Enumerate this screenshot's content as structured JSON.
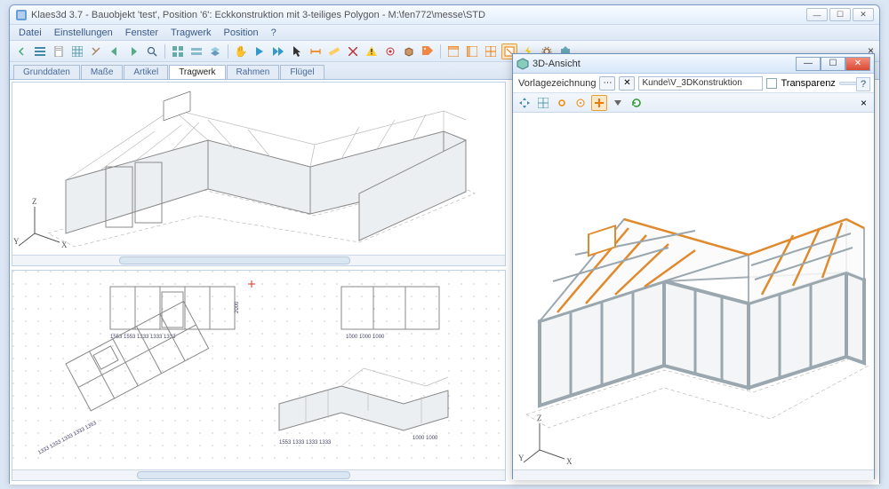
{
  "window": {
    "title": "Klaes3d 3.7 - Bauobjekt 'test', Position '6': Eckkonstruktion mit 3-teiliges Polygon  - M:\\fen772\\messe\\STD"
  },
  "menu": {
    "items": [
      "Datei",
      "Einstellungen",
      "Fenster",
      "Tragwerk",
      "Position",
      "?"
    ]
  },
  "toolbar": {
    "icons": [
      "chevron-left-icon",
      "list-icon",
      "document-icon",
      "grid-icon",
      "tools-icon",
      "arrow-left-icon",
      "arrow-right-icon",
      "search-icon",
      "sep",
      "thumbnails-icon",
      "stack-icon",
      "layers-icon",
      "sep",
      "hand-icon",
      "play-icon",
      "forward-icon",
      "pointer-icon",
      "dimension-icon",
      "measure-icon",
      "cross-icon",
      "warning-icon",
      "target-icon",
      "box-icon",
      "tag-icon",
      "sep",
      "layout1-icon",
      "layout2-icon",
      "layout3-icon",
      "inspect-icon",
      "lightning-icon",
      "gear-icon",
      "export-icon"
    ]
  },
  "tabs": {
    "items": [
      "Grunddaten",
      "Maße",
      "Artikel",
      "Tragwerk",
      "Rahmen",
      "Flügel"
    ],
    "active": 3
  },
  "axes": {
    "x": "X",
    "y": "Y",
    "z": "Z"
  },
  "dimensions_sample": [
    "1333",
    "1333",
    "1333",
    "1333",
    "1000",
    "1000",
    "2000",
    "1553",
    "1553",
    "1553",
    "1353",
    "1000",
    "1000"
  ],
  "panel3d": {
    "title": "3D-Ansicht",
    "row1": {
      "label": "Vorlagezeichnung",
      "field_value": "Kunde\\V_3DKonstruktion",
      "checkbox_label": "Transparenz"
    },
    "toolbar_icons": [
      "arrows-icon",
      "grid3-icon",
      "link-icon",
      "target2-icon",
      "plus-icon",
      "dropdown-icon",
      "refresh-icon"
    ]
  },
  "colors": {
    "accent_orange": "#e08a2e",
    "frame_gray": "#9aa7ae",
    "line_gray": "#888888",
    "bg_pane": "#ffffff"
  }
}
